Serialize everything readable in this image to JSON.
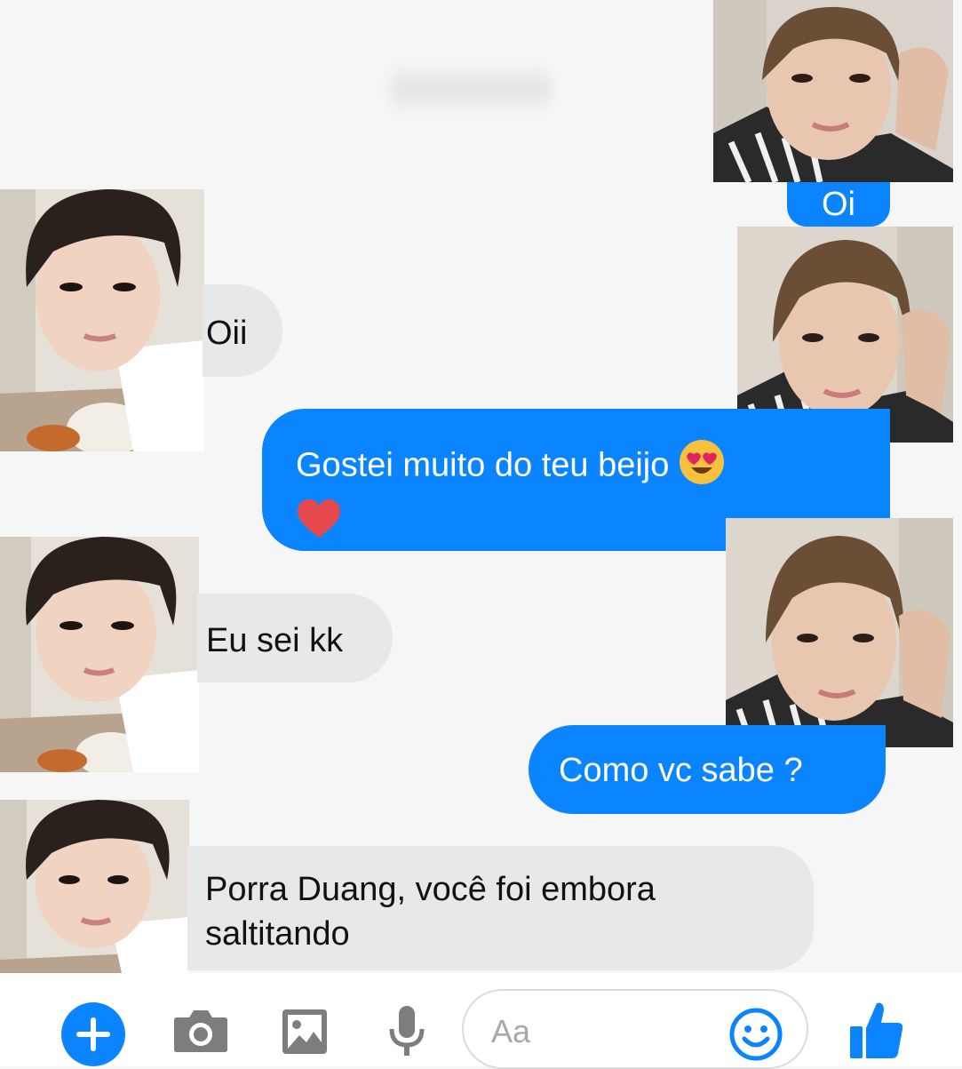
{
  "messages": [
    {
      "id": "m1",
      "side": "out",
      "text": "Oi"
    },
    {
      "id": "m2",
      "side": "in",
      "text": "Oii"
    },
    {
      "id": "m3",
      "side": "out",
      "text": "Gostei muito do teu beijo",
      "emoji_after": "heart-eyes",
      "second_line_emoji": "red-heart"
    },
    {
      "id": "m4",
      "side": "in",
      "text": "Eu sei kk"
    },
    {
      "id": "m5",
      "side": "out",
      "text": "Como vc sabe ?"
    },
    {
      "id": "m6",
      "side": "in",
      "line1": "Porra Duang, você foi embora",
      "line2": "saltitando"
    }
  ],
  "composer": {
    "placeholder": "Aa",
    "icons": [
      "plus-icon",
      "camera-icon",
      "image-icon",
      "microphone-icon",
      "emoji-icon",
      "thumbs-up-icon"
    ]
  },
  "colors": {
    "outgoing": "#0a84ff",
    "incoming": "#e8e8e8",
    "accent": "#0a84ff"
  }
}
